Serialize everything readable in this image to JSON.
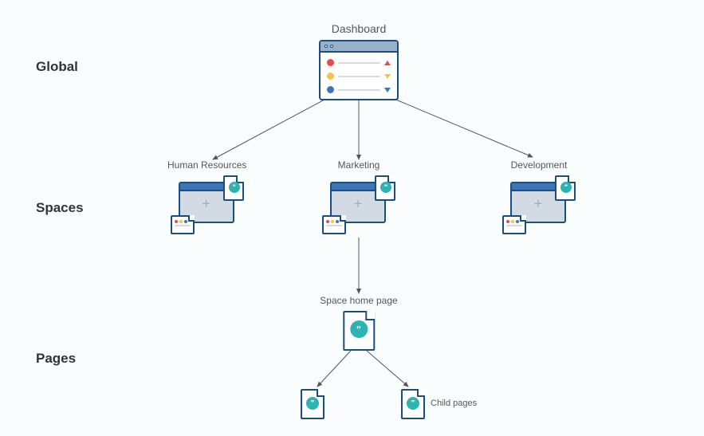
{
  "tiers": {
    "global": "Global",
    "spaces": "Spaces",
    "pages": "Pages"
  },
  "dashboard": {
    "label": "Dashboard"
  },
  "spaces_list": [
    {
      "label": "Human Resources"
    },
    {
      "label": "Marketing"
    },
    {
      "label": "Development"
    }
  ],
  "pages_section": {
    "home_label": "Space home page",
    "child_label": "Child pages"
  },
  "colors": {
    "border": "#1C4D7F",
    "accent": "#2EB2B2",
    "red": "#E34C4C",
    "yellow": "#F6C445",
    "blue": "#3C74B5"
  }
}
